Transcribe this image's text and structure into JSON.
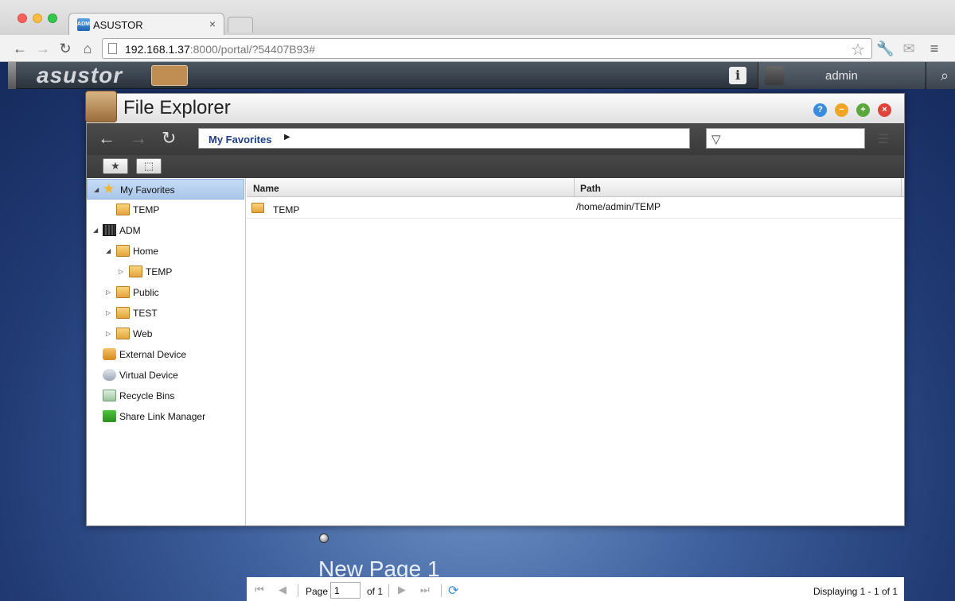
{
  "browser": {
    "tab_title": "ASUSTOR",
    "tab_favicon_text": "ADM",
    "url_host": "192.168.1.37",
    "url_rest": ":8000/portal/?54407B93#"
  },
  "desktop": {
    "logo": "asustor",
    "user_name": "admin",
    "page_label": "New Page 1"
  },
  "window": {
    "title": "File Explorer",
    "breadcrumb": "My Favorites"
  },
  "sidebar": {
    "items": [
      {
        "label": "My Favorites"
      },
      {
        "label": "TEMP"
      },
      {
        "label": "ADM"
      },
      {
        "label": "Home"
      },
      {
        "label": "TEMP"
      },
      {
        "label": "Public"
      },
      {
        "label": "TEST"
      },
      {
        "label": "Web"
      },
      {
        "label": "External Device"
      },
      {
        "label": "Virtual Device"
      },
      {
        "label": "Recycle Bins"
      },
      {
        "label": "Share Link Manager"
      }
    ]
  },
  "grid": {
    "columns": [
      "Name",
      "Path"
    ],
    "rows": [
      {
        "name": "TEMP",
        "path": "/home/admin/TEMP"
      }
    ]
  },
  "pager": {
    "page_label": "Page",
    "page_value": "1",
    "of_label": "of 1",
    "display_text": "Displaying 1 - 1 of 1"
  }
}
